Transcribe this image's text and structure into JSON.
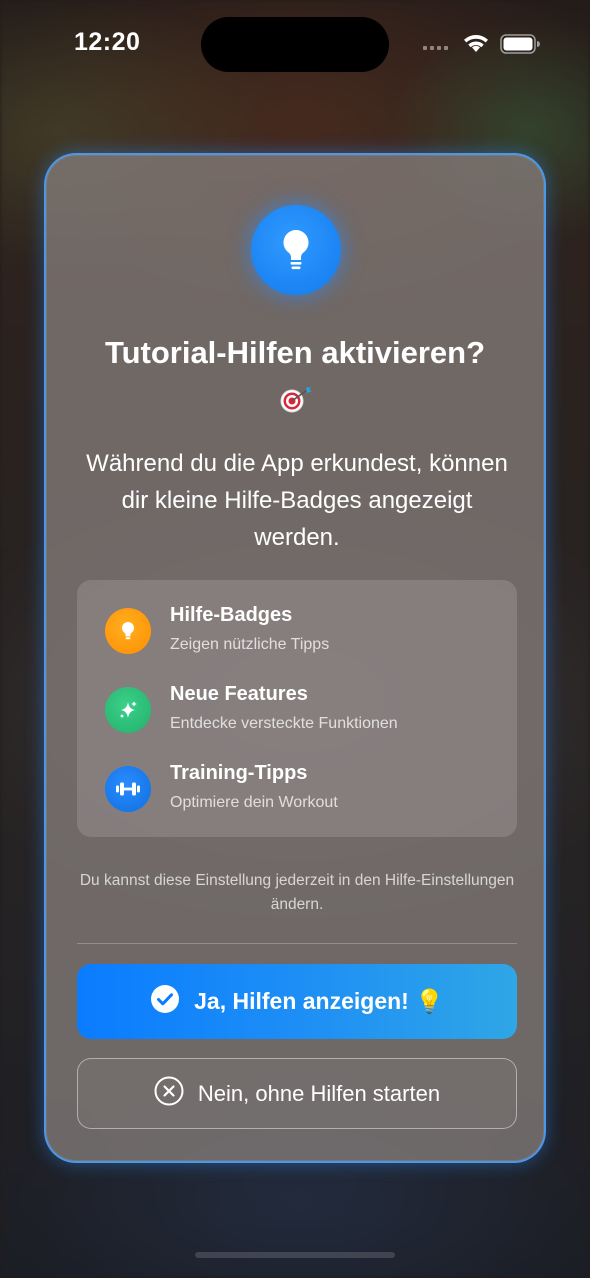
{
  "status_bar": {
    "time": "12:20"
  },
  "modal": {
    "header_icon": "lightbulb-icon",
    "title": "Tutorial-Hilfen aktivieren?",
    "title_emoji": "dart-target-emoji",
    "subtitle": "Während du die App erkundest, können dir kleine Hilfe-Badges angezeigt werden.",
    "features": [
      {
        "icon": "lightbulb-icon",
        "icon_color": "#FF9F0A",
        "title": "Hilfe-Badges",
        "description": "Zeigen nützliche Tipps"
      },
      {
        "icon": "sparkles-icon",
        "icon_color": "#30C27A",
        "title": "Neue Features",
        "description": "Entdecke versteckte Funktionen"
      },
      {
        "icon": "dumbbell-icon",
        "icon_color": "#1A7FF0",
        "title": "Training-Tipps",
        "description": "Optimiere dein Workout"
      }
    ],
    "footnote": "Du kannst diese Einstellung jederzeit in den Hilfe-Einstellungen ändern.",
    "primary_button": {
      "label": "Ja, Hilfen anzeigen! 💡",
      "icon": "checkmark-circle-icon"
    },
    "secondary_button": {
      "label": "Nein, ohne Hilfen starten",
      "icon": "xmark-circle-icon"
    }
  },
  "colors": {
    "accent": "#0A7CFF",
    "card_border": "#46A0FF"
  }
}
